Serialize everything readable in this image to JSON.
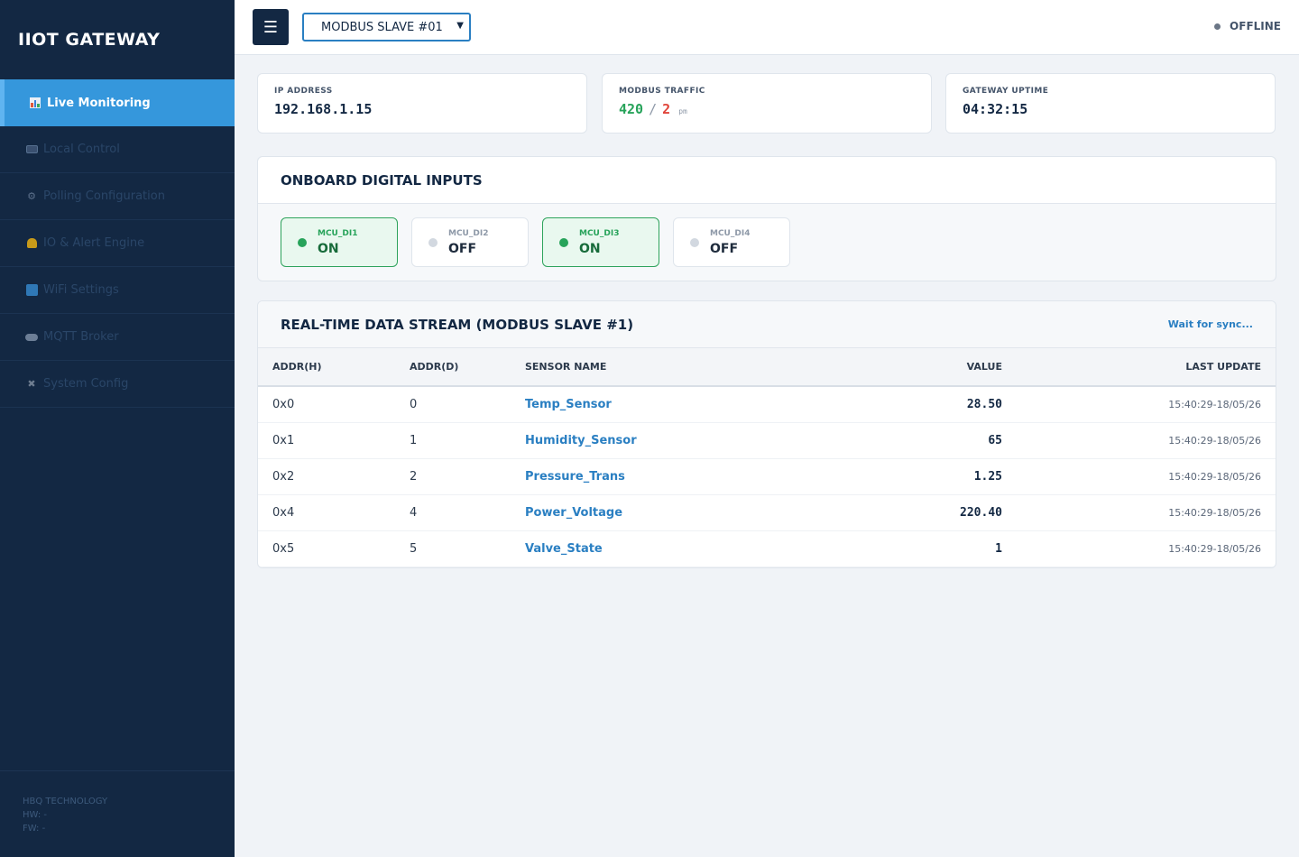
{
  "app": {
    "title": "IIOT GATEWAY"
  },
  "sidebar": {
    "items": [
      {
        "label": "Live Monitoring",
        "icon": "chart-icon",
        "active": true
      },
      {
        "label": "Local Control",
        "icon": "keyboard-icon"
      },
      {
        "label": "Polling Configuration",
        "icon": "gear-icon"
      },
      {
        "label": "IO & Alert Engine",
        "icon": "bell-icon"
      },
      {
        "label": "WiFi Settings",
        "icon": "wifi-icon"
      },
      {
        "label": "MQTT Broker",
        "icon": "cloud-icon"
      },
      {
        "label": "System Config",
        "icon": "tools-icon"
      }
    ],
    "footer": {
      "company": "HBQ TECHNOLOGY",
      "hw": "HW: -",
      "fw": "FW: -"
    }
  },
  "topbar": {
    "menu_glyph": "☰",
    "slave_select": "MODBUS SLAVE #01",
    "status": "OFFLINE"
  },
  "stats": {
    "ip": {
      "label": "IP ADDRESS",
      "value": "192.168.1.15"
    },
    "traffic": {
      "label": "MODBUS TRAFFIC",
      "ok": "420",
      "sep": "/",
      "err": "2",
      "unit": "pm"
    },
    "uptime": {
      "label": "GATEWAY UPTIME",
      "value": "04:32:15"
    }
  },
  "digital_inputs": {
    "title": "ONBOARD DIGITAL INPUTS",
    "items": [
      {
        "name": "MCU_DI1",
        "state": "ON"
      },
      {
        "name": "MCU_DI2",
        "state": "OFF"
      },
      {
        "name": "MCU_DI3",
        "state": "ON"
      },
      {
        "name": "MCU_DI4",
        "state": "OFF"
      }
    ]
  },
  "stream": {
    "title": "REAL-TIME DATA STREAM (MODBUS SLAVE #1)",
    "sync_label": "Wait for sync...",
    "columns": [
      "ADDR(H)",
      "ADDR(D)",
      "SENSOR NAME",
      "VALUE",
      "LAST UPDATE"
    ],
    "rows": [
      {
        "addr_h": "0x0",
        "addr_d": "0",
        "name": "Temp_Sensor",
        "value": "28.50",
        "updated": "15:40:29-18/05/26"
      },
      {
        "addr_h": "0x1",
        "addr_d": "1",
        "name": "Humidity_Sensor",
        "value": "65",
        "updated": "15:40:29-18/05/26"
      },
      {
        "addr_h": "0x2",
        "addr_d": "2",
        "name": "Pressure_Trans",
        "value": "1.25",
        "updated": "15:40:29-18/05/26"
      },
      {
        "addr_h": "0x4",
        "addr_d": "4",
        "name": "Power_Voltage",
        "value": "220.40",
        "updated": "15:40:29-18/05/26"
      },
      {
        "addr_h": "0x5",
        "addr_d": "5",
        "name": "Valve_State",
        "value": "1",
        "updated": "15:40:29-18/05/26"
      }
    ]
  },
  "colors": {
    "sidebar_bg": "#132843",
    "accent": "#3597dc",
    "on_green": "#27a35a",
    "error_red": "#e0443a",
    "link_blue": "#2a7fc2"
  }
}
